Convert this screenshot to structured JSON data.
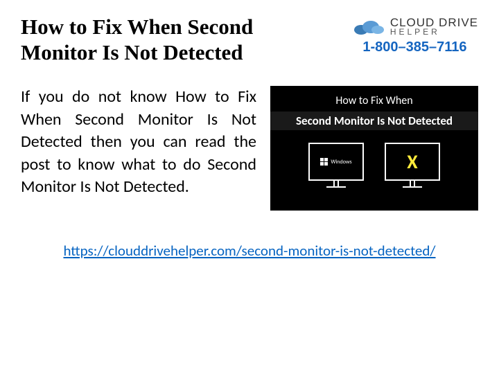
{
  "header": {
    "title": "How to Fix When Second Monitor Is Not Detected",
    "logo_main": "CLOUD DRIVE",
    "logo_sub": "HELPER",
    "phone": "1-800–385–7116"
  },
  "body": {
    "paragraph": "If you do not know How to Fix When Second Monitor Is Not Detected then you can read the post to know what to do Second Monitor Is Not Detected."
  },
  "thumbnail": {
    "line1": "How to Fix When",
    "line2": "Second Monitor Is Not Detected",
    "monitor1_label": "Windows",
    "monitor2_label": "X"
  },
  "link": {
    "text": "https://clouddrivehelper.com/second-monitor-is-not-detected/"
  }
}
